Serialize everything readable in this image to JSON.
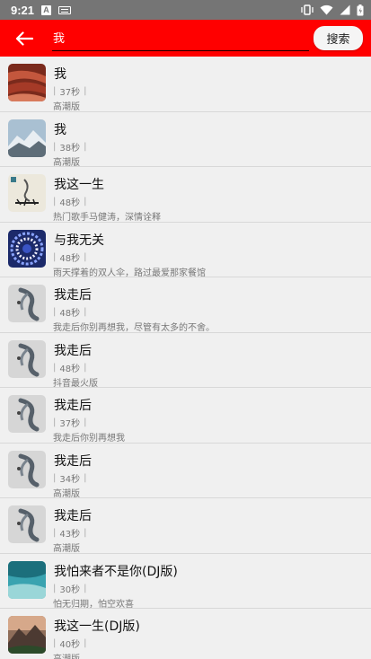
{
  "status_bar": {
    "time": "9:21",
    "a_icon": "A"
  },
  "toolbar": {
    "search_value": "我",
    "search_button_label": "搜索"
  },
  "songs": [
    {
      "title": "我",
      "duration": "37秒",
      "desc": "高潮版",
      "thumb": "red-canyon"
    },
    {
      "title": "我",
      "duration": "38秒",
      "desc": "高潮版",
      "thumb": "snow-mountain"
    },
    {
      "title": "我这一生",
      "duration": "48秒",
      "desc": "热门歌手马健涛，深情诠释",
      "thumb": "calligraphy"
    },
    {
      "title": "与我无关",
      "duration": "48秒",
      "desc": "雨天撑着的双人伞，路过最爱那家餐馆",
      "thumb": "blue-spiral"
    },
    {
      "title": "我走后",
      "duration": "48秒",
      "desc": "我走后你别再想我，尽管有太多的不舍。",
      "thumb": "gray-ink"
    },
    {
      "title": "我走后",
      "duration": "48秒",
      "desc": "抖音最火版",
      "thumb": "gray-ink"
    },
    {
      "title": "我走后",
      "duration": "37秒",
      "desc": "我走后你别再想我",
      "thumb": "gray-ink"
    },
    {
      "title": "我走后",
      "duration": "34秒",
      "desc": "高潮版",
      "thumb": "gray-ink"
    },
    {
      "title": "我走后",
      "duration": "43秒",
      "desc": "高潮版",
      "thumb": "gray-ink"
    },
    {
      "title": "我怕来者不是你(DJ版)",
      "duration": "30秒",
      "desc": "怕无归期，怕空欢喜",
      "thumb": "teal-water"
    },
    {
      "title": "我这一生(DJ版)",
      "duration": "40秒",
      "desc": "高潮版",
      "thumb": "sunset-mountain"
    }
  ],
  "colors": {
    "toolbar": "#ff0000",
    "status_bar": "#757575",
    "list_bg": "#f0f0f0"
  }
}
